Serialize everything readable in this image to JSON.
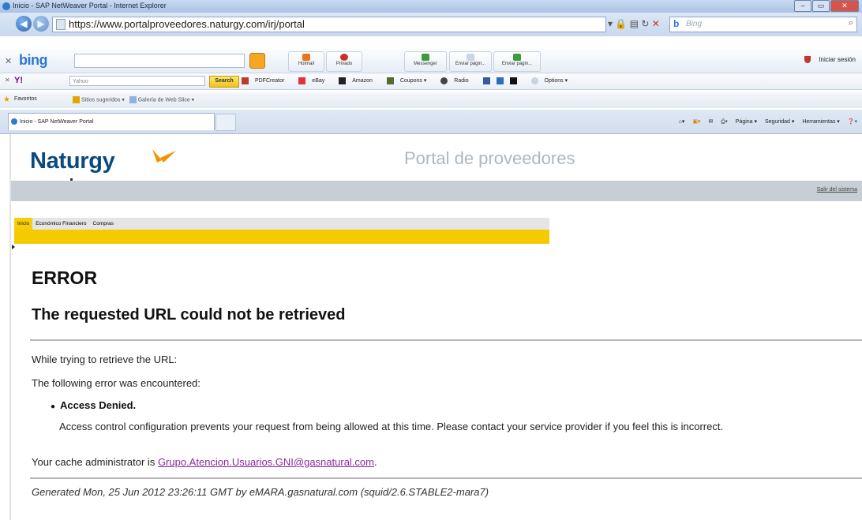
{
  "window": {
    "title": "Inicio - SAP NetWeaver Portal - Internet Explorer",
    "buttons": [
      "–",
      "▭",
      "✕"
    ]
  },
  "address_bar": {
    "url": "https://www.portalproveedores.naturgy.com/irj/portal",
    "search_placeholder": "Bing",
    "search_brand": "b"
  },
  "bing_toolbar": {
    "brand": "bing",
    "buttons": [
      {
        "label": "Hotmail",
        "color": "#e9731c"
      },
      {
        "label": "Privado",
        "color": "#d12c2c"
      },
      {
        "label": "Messenger",
        "color": "#3c9c3c"
      },
      {
        "label": "Enviar págin...",
        "color": "#8aa0c0"
      },
      {
        "label": "Enviar págin...",
        "color": "#3c9c3c"
      }
    ],
    "signin": "Iniciar sesión"
  },
  "yahoo_toolbar": {
    "brand": "Y!",
    "search_value": "Yahoo",
    "search_button": "Search",
    "items": [
      "PDFCreator",
      "eBay",
      "Amazon",
      "Coupons ▾",
      "Radio",
      "Options ▾"
    ]
  },
  "favorites_bar": {
    "label": "Favoritos",
    "items": [
      "Sitios sugeridos ▾",
      "Galería de Web Slice ▾"
    ]
  },
  "tab": {
    "title": "Inicio - SAP NetWeaver Portal"
  },
  "command_bar": {
    "items": [
      "Página ▾",
      "Seguridad ▾",
      "Herramientas ▾"
    ]
  },
  "portal": {
    "logo_text": "Naturgy",
    "title": "Portal de proveedores",
    "logout": "Salir del sistema",
    "nav_tabs": [
      "Inicio",
      "Económico Financiero",
      "Compras"
    ],
    "active_tab": "Inicio"
  },
  "error_page": {
    "h1": "ERROR",
    "h2": "The requested URL could not be retrieved",
    "line1": "While trying to retrieve the URL:",
    "line2": "The following error was encountered:",
    "bullet": "Access Denied.",
    "detail": "Access control configuration prevents your request from being allowed at this time. Please contact your service provider if you feel this is incorrect.",
    "admin_prefix": "Your cache administrator is ",
    "admin_email": "Grupo.Atencion.Usuarios.GNI@gasnatural.com",
    "admin_suffix": ".",
    "footer": "Generated Mon, 25 Jun 2012 23:26:11 GMT by eMARA.gasnatural.com (squid/2.6.STABLE2-mara7)"
  },
  "colors": {
    "brand_blue": "#0b4a80",
    "brand_orange": "#f39200",
    "nav_yellow": "#f6ca00",
    "link_purple": "#8a2a9a"
  }
}
